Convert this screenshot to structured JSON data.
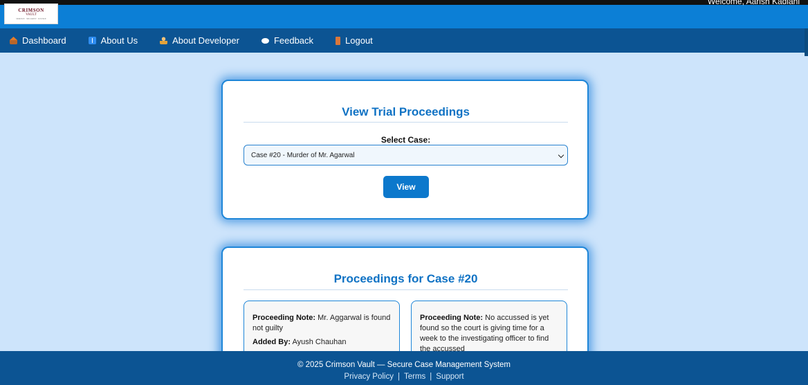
{
  "header": {
    "logo": {
      "line1": "CRIMSON",
      "line2": "VAULT",
      "line3": "SERVICE · SECURITY · JUSTICE"
    },
    "welcome_text": "Welcome, Aarish Kadiani"
  },
  "nav": {
    "items": [
      {
        "label": "Dashboard",
        "icon": "home-icon"
      },
      {
        "label": "About Us",
        "icon": "info-icon"
      },
      {
        "label": "About Developer",
        "icon": "developer-icon"
      },
      {
        "label": "Feedback",
        "icon": "chat-bubble-icon"
      },
      {
        "label": "Logout",
        "icon": "door-icon"
      }
    ]
  },
  "view_panel": {
    "title": "View Trial Proceedings",
    "select_label": "Select Case:",
    "selected_case": "Case #20 - Murder of Mr. Agarwal",
    "button_label": "View"
  },
  "proceedings": {
    "title": "Proceedings for Case #20",
    "note_label": "Proceeding Note:",
    "added_by_label": "Added By:",
    "items": [
      {
        "note": "Mr. Aggarwal is found not guilty",
        "added_by": "Ayush Chauhan"
      },
      {
        "note": "No accussed is yet found so the court is giving time for a week to the investigating officer to find the accussed"
      }
    ]
  },
  "footer": {
    "copyright": "© 2025 Crimson Vault — Secure Case Management System",
    "links": [
      "Privacy Policy",
      "Terms",
      "Support"
    ],
    "separator": "|"
  },
  "colors": {
    "topbar": "#0c7fd6",
    "navbar": "#0c5493",
    "page_background": "#cde4fb",
    "accent": "#0c78cc",
    "title_blue": "#0f72c4"
  }
}
